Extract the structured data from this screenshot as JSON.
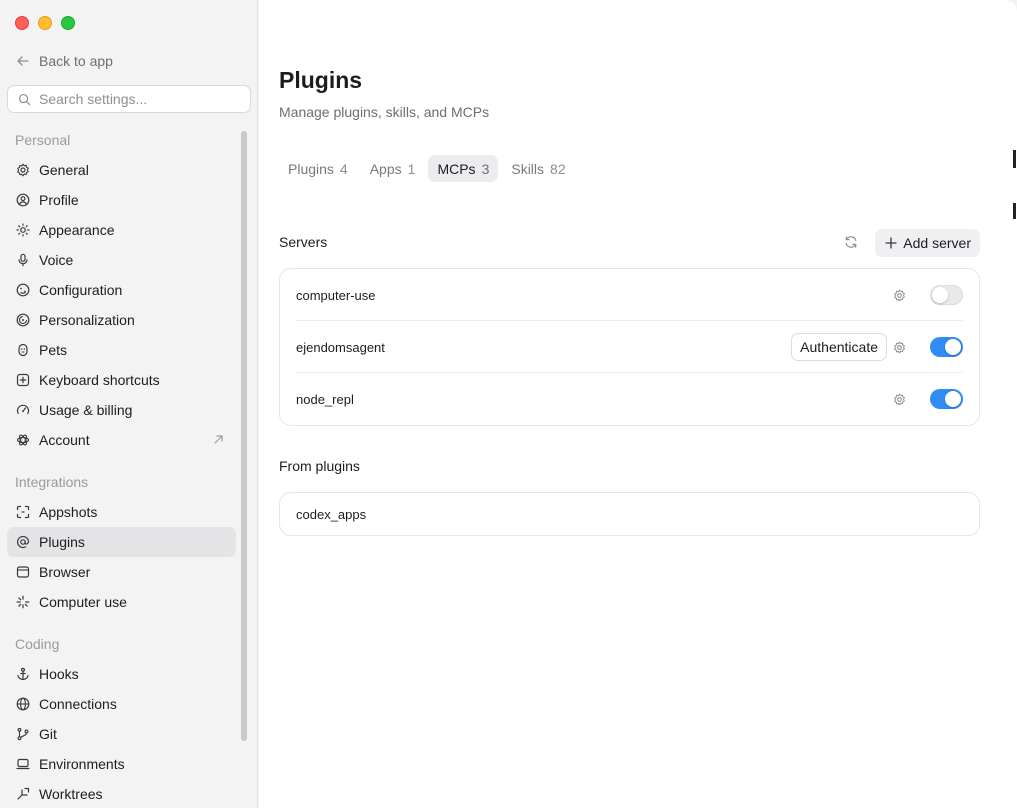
{
  "window": {
    "controls": [
      "close",
      "minimize",
      "zoom"
    ]
  },
  "sidebar": {
    "back_label": "Back to app",
    "search_placeholder": "Search settings...",
    "sections": [
      {
        "title": "Personal",
        "items": [
          {
            "label": "General",
            "icon": "gear-icon"
          },
          {
            "label": "Profile",
            "icon": "person-circle-icon"
          },
          {
            "label": "Appearance",
            "icon": "sun-icon"
          },
          {
            "label": "Voice",
            "icon": "microphone-icon"
          },
          {
            "label": "Configuration",
            "icon": "sliders-icon"
          },
          {
            "label": "Personalization",
            "icon": "palette-icon"
          },
          {
            "label": "Pets",
            "icon": "pet-icon"
          },
          {
            "label": "Keyboard shortcuts",
            "icon": "keyboard-command-icon"
          },
          {
            "label": "Usage & billing",
            "icon": "gauge-icon"
          },
          {
            "label": "Account",
            "icon": "openai-logo-icon"
          }
        ]
      },
      {
        "title": "Integrations",
        "items": [
          {
            "label": "Appshots",
            "icon": "screenshot-frame-icon"
          },
          {
            "label": "Plugins",
            "icon": "at-sign-icon"
          },
          {
            "label": "Browser",
            "icon": "browser-window-icon"
          },
          {
            "label": "Computer use",
            "icon": "sparkle-icon"
          }
        ]
      },
      {
        "title": "Coding",
        "items": [
          {
            "label": "Hooks",
            "icon": "anchor-icon"
          },
          {
            "label": "Connections",
            "icon": "globe-icon"
          },
          {
            "label": "Git",
            "icon": "git-branch-icon"
          },
          {
            "label": "Environments",
            "icon": "laptop-icon"
          },
          {
            "label": "Worktrees",
            "icon": "worktree-icon"
          }
        ]
      }
    ],
    "active_item": "Plugins"
  },
  "main": {
    "title": "Plugins",
    "subtitle": "Manage plugins, skills, and MCPs",
    "tabs": [
      {
        "label": "Plugins",
        "count": "4"
      },
      {
        "label": "Apps",
        "count": "1"
      },
      {
        "label": "MCPs",
        "count": "3"
      },
      {
        "label": "Skills",
        "count": "82"
      }
    ],
    "active_tab": "MCPs",
    "servers": {
      "label": "Servers",
      "add_label": "Add server",
      "items": [
        {
          "name": "computer-use",
          "enabled": false,
          "action": ""
        },
        {
          "name": "ejendomsagent",
          "enabled": true,
          "action": "Authenticate"
        },
        {
          "name": "node_repl",
          "enabled": true,
          "action": ""
        }
      ]
    },
    "from_plugins": {
      "label": "From plugins",
      "items": [
        {
          "name": "codex_apps"
        }
      ]
    }
  },
  "colors": {
    "accent": "#2f8cf2",
    "sidebar_bg": "#f3f3f4",
    "active_item_bg": "#e4e4e6"
  }
}
